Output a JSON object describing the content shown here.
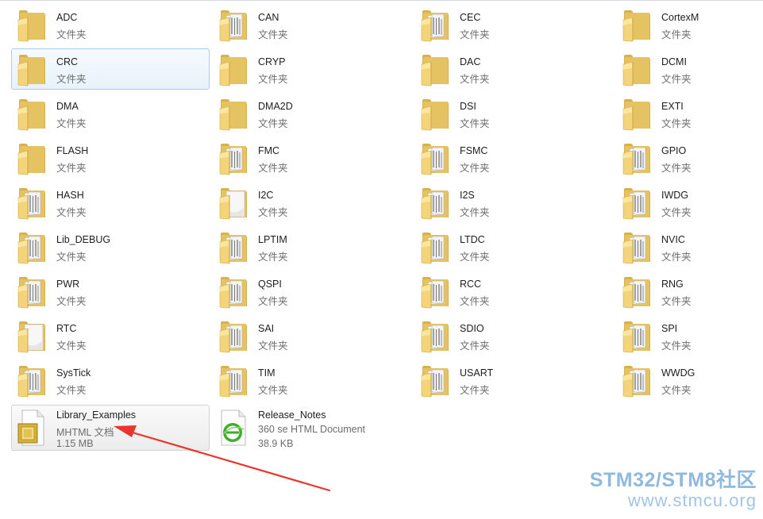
{
  "folders": [
    {
      "name": "ADC",
      "type": "文件夹",
      "variant": "plain"
    },
    {
      "name": "CAN",
      "type": "文件夹",
      "variant": "docs"
    },
    {
      "name": "CEC",
      "type": "文件夹",
      "variant": "docs"
    },
    {
      "name": "CortexM",
      "type": "文件夹",
      "variant": "plain"
    },
    {
      "name": "CRC",
      "type": "文件夹",
      "variant": "plain"
    },
    {
      "name": "CRYP",
      "type": "文件夹",
      "variant": "plain"
    },
    {
      "name": "DAC",
      "type": "文件夹",
      "variant": "plain"
    },
    {
      "name": "DCMI",
      "type": "文件夹",
      "variant": "plain"
    },
    {
      "name": "DMA",
      "type": "文件夹",
      "variant": "plain"
    },
    {
      "name": "DMA2D",
      "type": "文件夹",
      "variant": "plain"
    },
    {
      "name": "DSI",
      "type": "文件夹",
      "variant": "plain"
    },
    {
      "name": "EXTI",
      "type": "文件夹",
      "variant": "plain"
    },
    {
      "name": "FLASH",
      "type": "文件夹",
      "variant": "plain"
    },
    {
      "name": "FMC",
      "type": "文件夹",
      "variant": "docs"
    },
    {
      "name": "FSMC",
      "type": "文件夹",
      "variant": "docs"
    },
    {
      "name": "GPIO",
      "type": "文件夹",
      "variant": "docs"
    },
    {
      "name": "HASH",
      "type": "文件夹",
      "variant": "docs"
    },
    {
      "name": "I2C",
      "type": "文件夹",
      "variant": "sheet"
    },
    {
      "name": "I2S",
      "type": "文件夹",
      "variant": "docs"
    },
    {
      "name": "IWDG",
      "type": "文件夹",
      "variant": "docs"
    },
    {
      "name": "Lib_DEBUG",
      "type": "文件夹",
      "variant": "docs"
    },
    {
      "name": "LPTIM",
      "type": "文件夹",
      "variant": "docs"
    },
    {
      "name": "LTDC",
      "type": "文件夹",
      "variant": "docs"
    },
    {
      "name": "NVIC",
      "type": "文件夹",
      "variant": "docs"
    },
    {
      "name": "PWR",
      "type": "文件夹",
      "variant": "docs"
    },
    {
      "name": "QSPI",
      "type": "文件夹",
      "variant": "docs"
    },
    {
      "name": "RCC",
      "type": "文件夹",
      "variant": "docs"
    },
    {
      "name": "RNG",
      "type": "文件夹",
      "variant": "docs"
    },
    {
      "name": "RTC",
      "type": "文件夹",
      "variant": "sheet"
    },
    {
      "name": "SAI",
      "type": "文件夹",
      "variant": "docs"
    },
    {
      "name": "SDIO",
      "type": "文件夹",
      "variant": "docs"
    },
    {
      "name": "SPI",
      "type": "文件夹",
      "variant": "docs"
    },
    {
      "name": "SysTick",
      "type": "文件夹",
      "variant": "docs"
    },
    {
      "name": "TIM",
      "type": "文件夹",
      "variant": "docs"
    },
    {
      "name": "USART",
      "type": "文件夹",
      "variant": "docs"
    },
    {
      "name": "WWDG",
      "type": "文件夹",
      "variant": "docs"
    }
  ],
  "files": [
    {
      "name": "Library_Examples",
      "type": "MHTML 文档",
      "size": "1.15 MB",
      "icon": "mhtml-document-icon"
    },
    {
      "name": "Release_Notes",
      "type": "360 se HTML Document",
      "size": "38.9 KB",
      "icon": "html-document-icon"
    }
  ],
  "selected_folder": "CRC",
  "highlighted_file": "Library_Examples",
  "colors": {
    "selection_border": "#a9cdee",
    "selection_fill": "#e8f2fc",
    "arrow": "#e8362c",
    "watermark": "#8fb9de"
  },
  "watermark": {
    "title": "STM32/STM8社区",
    "url": "www.stmcu.org"
  }
}
